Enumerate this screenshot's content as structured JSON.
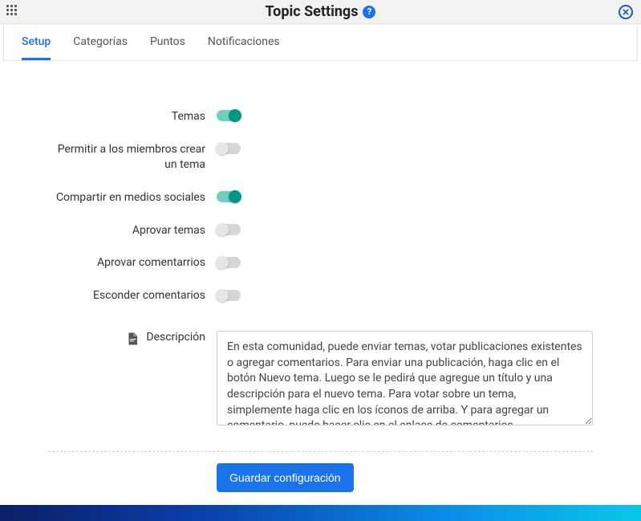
{
  "header": {
    "title": "Topic Settings"
  },
  "tabs": [
    {
      "label": "Setup",
      "active": true
    },
    {
      "label": "Categorías",
      "active": false
    },
    {
      "label": "Puntos",
      "active": false
    },
    {
      "label": "Notificaciones",
      "active": false
    }
  ],
  "toggles": [
    {
      "label": "Temas",
      "on": true
    },
    {
      "label": "Permitir a los miembros crear un tema",
      "on": false
    },
    {
      "label": "Compartir en medios sociales",
      "on": true
    },
    {
      "label": "Aprovar temas",
      "on": false
    },
    {
      "label": "Aprovar comentarrios",
      "on": false
    },
    {
      "label": "Esconder comentarios",
      "on": false
    }
  ],
  "description": {
    "label": "Descripción",
    "value": "En esta comunidad, puede enviar temas, votar publicaciones existentes o agregar comentarios. Para enviar una publicación, haga clic en el botón Nuevo tema. Luego se le pedirá que agregue un título y una descripción para el nuevo tema. Para votar sobre un tema, simplemente haga clic en los íconos de arriba. Y para agregar un comentario, puede hacer clic en el enlace de comentarios."
  },
  "actions": {
    "save_label": "Guardar configuración"
  }
}
